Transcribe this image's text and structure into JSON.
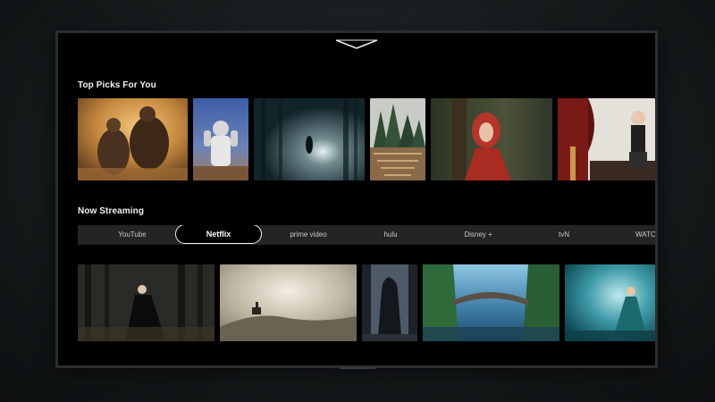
{
  "screen": {
    "collapse_icon": "chevron-down-icon"
  },
  "top_picks": {
    "title": "Top Picks For You",
    "items": [
      {
        "icon": "desert-warriors-thumbnail"
      },
      {
        "icon": "astronaut-thumbnail"
      },
      {
        "icon": "foggy-forest-thumbnail"
      },
      {
        "icon": "maze-forest-thumbnail"
      },
      {
        "icon": "red-hood-girl-thumbnail"
      },
      {
        "icon": "girl-theater-thumbnail"
      }
    ]
  },
  "now_streaming": {
    "title": "Now Streaming",
    "providers": [
      {
        "label": "YouTube",
        "selected": false
      },
      {
        "label": "Netflix",
        "selected": true
      },
      {
        "label": "prime video",
        "selected": false
      },
      {
        "label": "hulu",
        "selected": false
      },
      {
        "label": "Disney +",
        "selected": false
      },
      {
        "label": "tvN",
        "selected": false
      },
      {
        "label": "WATC",
        "selected": false
      }
    ],
    "items": [
      {
        "icon": "dark-forest-woman-thumbnail"
      },
      {
        "icon": "horse-rider-thumbnail"
      },
      {
        "icon": "hooded-figure-thumbnail"
      },
      {
        "icon": "stone-bridge-thumbnail"
      },
      {
        "icon": "blue-mist-girl-thumbnail"
      }
    ]
  },
  "colors": {
    "background": "#000000",
    "provider_bar": "#222426",
    "text": "#f2f2f2",
    "selected_outline": "#f0f0f0"
  }
}
